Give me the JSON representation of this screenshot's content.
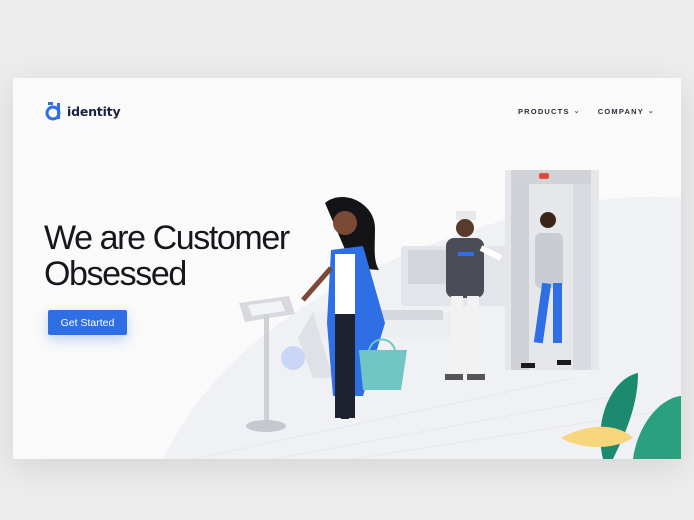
{
  "brand": {
    "name": "identity",
    "logo_icon": "identity-d-logo-icon",
    "accent": "#2e6fe6"
  },
  "nav": {
    "items": [
      {
        "label": "PRODUCTS",
        "icon": "chevron-down-icon"
      },
      {
        "label": "COMPANY",
        "icon": "chevron-down-icon"
      }
    ]
  },
  "hero": {
    "title_line1": "We are Customer",
    "title_line2": "Obsessed",
    "cta_label": "Get Started"
  },
  "illustration": {
    "description_icons": [
      "woman-with-bag",
      "kiosk-terminal",
      "security-guard",
      "metal-detector-gate",
      "traveler",
      "plant-leaves"
    ]
  }
}
